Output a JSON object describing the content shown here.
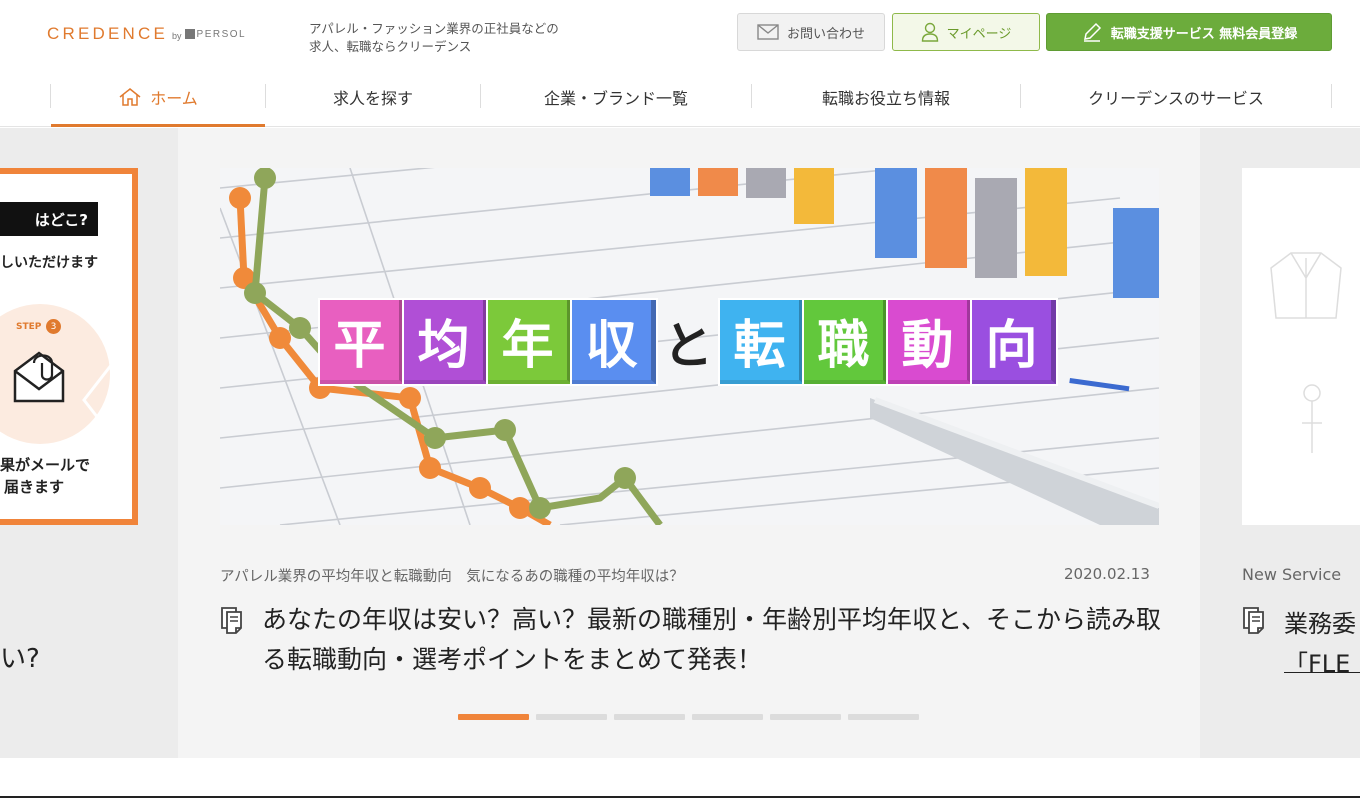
{
  "header": {
    "logo_main": "CREDENCE",
    "logo_by": "by",
    "logo_persol": "PERSOL",
    "tagline_line1": "アパレル・ファッション業界の正社員などの",
    "tagline_line2": "求人、転職ならクリーデンス",
    "contact_label": "お問い合わせ",
    "mypage_label": "マイページ",
    "register_label": "転職支援サービス 無料会員登録"
  },
  "nav": {
    "items": [
      {
        "label": "ホーム"
      },
      {
        "label": "求人を探す"
      },
      {
        "label": "企業・ブランド一覧"
      },
      {
        "label": "転職お役立ち情報"
      },
      {
        "label": "クリーデンスのサービス"
      }
    ]
  },
  "carousel": {
    "prev": {
      "bar_text": "はどこ?",
      "line1": "しいただけます",
      "step_label": "STEP",
      "step_num": "3",
      "line2a": "果がメールで",
      "line2b": "届きます",
      "title_tail": "い?"
    },
    "current": {
      "banner_chars": [
        "平",
        "均",
        "年",
        "収",
        "と",
        "転",
        "職",
        "動",
        "向"
      ],
      "category": "アパレル業界の平均年収と転職動向　気になるあの職種の平均年収は？",
      "date": "2020.02.13",
      "title": "あなたの年収は安い？高い？最新の職種別・年齢別平均年収と、そこから読み取る転職動向・選考ポイントをまとめて発表！"
    },
    "next": {
      "label": "New Service",
      "title_line1": "業務委",
      "title_line2": "「FLE"
    },
    "indicator_count": 6,
    "active_index": 0
  },
  "colors": {
    "accent": "#e07a2e",
    "green": "#6cac3c",
    "tiles": [
      "#e85fc0",
      "#b04fd6",
      "#7cc93a",
      "#5a8ef0",
      "",
      "#3fb3f0",
      "#62c83c",
      "#d94bd0",
      "#9a4fe0"
    ]
  }
}
